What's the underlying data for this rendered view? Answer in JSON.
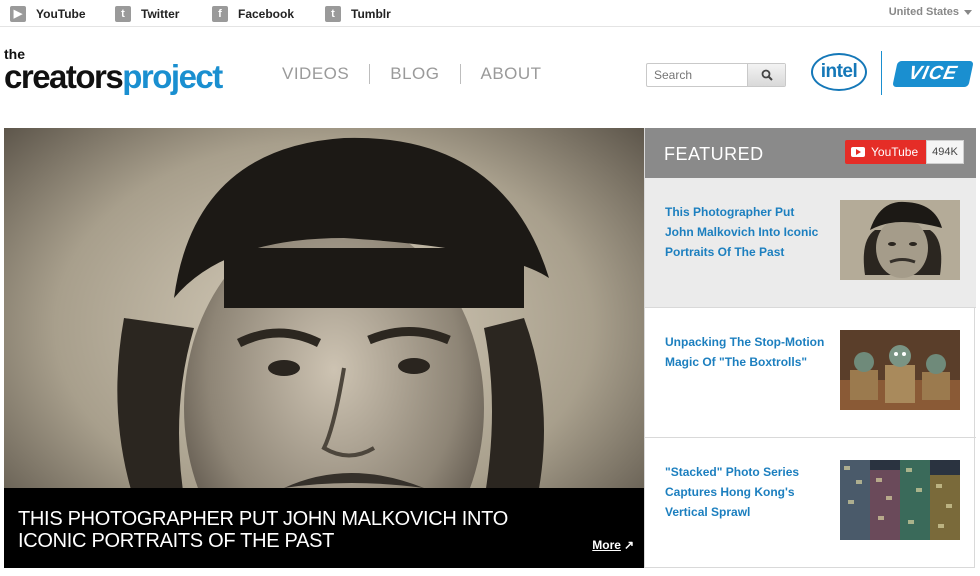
{
  "social": [
    {
      "label": "YouTube",
      "glyph": "▶",
      "icon": "youtube-icon"
    },
    {
      "label": "Twitter",
      "glyph": "t",
      "icon": "twitter-icon"
    },
    {
      "label": "Facebook",
      "glyph": "f",
      "icon": "facebook-icon"
    },
    {
      "label": "Tumblr",
      "glyph": "t",
      "icon": "tumblr-icon"
    }
  ],
  "region": "United States",
  "logo": {
    "the": "the",
    "part1": "creators",
    "part2": "project"
  },
  "nav": [
    "VIDEOS",
    "BLOG",
    "ABOUT"
  ],
  "search": {
    "placeholder": "Search",
    "icon": "search-icon"
  },
  "partners": {
    "intel": "intel",
    "vice": "VICE"
  },
  "hero": {
    "title": "THIS PHOTOGRAPHER PUT JOHN MALKOVICH INTO ICONIC PORTRAITS OF THE PAST",
    "more": "More",
    "more_arrow": "↗"
  },
  "featured": {
    "title": "FEATURED",
    "youtube_label": "YouTube",
    "youtube_count": "494K",
    "items": [
      {
        "title": "This Photographer Put John Malkovich Into Iconic Portraits Of The Past"
      },
      {
        "title": "Unpacking The Stop-Motion Magic Of \"The Boxtrolls\""
      },
      {
        "title": "\"Stacked\" Photo Series Captures Hong Kong's Vertical Sprawl"
      }
    ]
  },
  "colors": {
    "accent": "#1a8fd0",
    "link": "#1c7fbf",
    "youtube_red": "#e52d27",
    "featured_header": "#8a8a8a"
  }
}
